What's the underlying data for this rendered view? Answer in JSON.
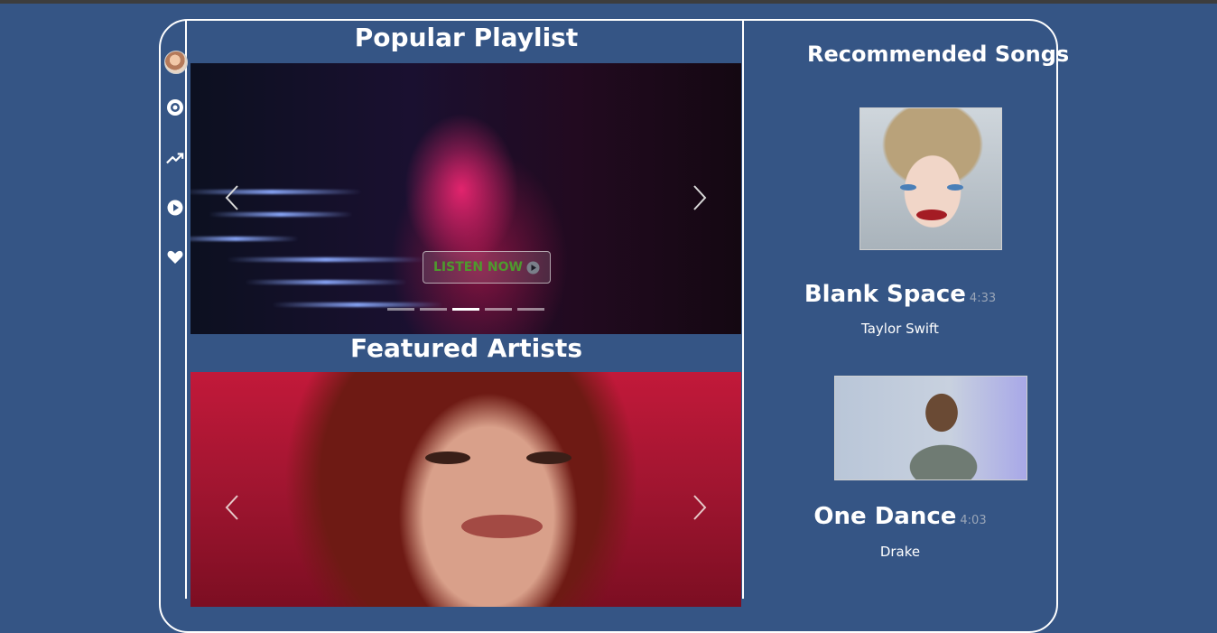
{
  "sidebar": {
    "items": [
      {
        "icon": "avatar"
      },
      {
        "icon": "disc-icon"
      },
      {
        "icon": "trending-icon"
      },
      {
        "icon": "play-circle-icon"
      },
      {
        "icon": "heart-icon"
      }
    ]
  },
  "main": {
    "playlist_title": "Popular Playlist",
    "listen_now_label": "LISTEN NOW",
    "carousel_slide_count": 5,
    "carousel_active_index": 2,
    "featured_title": "Featured Artists"
  },
  "recommended": {
    "title": "Recommended Songs",
    "songs": [
      {
        "title": "Blank Space",
        "duration": "4:33",
        "artist": "Taylor Swift"
      },
      {
        "title": "One Dance",
        "duration": "4:03",
        "artist": "Drake"
      }
    ]
  },
  "colors": {
    "background": "#355585",
    "listen_now_text": "#4e9a2e",
    "duration_text": "#9aa6b8"
  }
}
